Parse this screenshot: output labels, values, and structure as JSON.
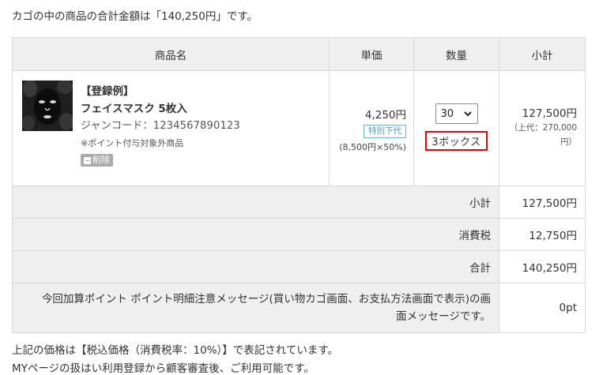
{
  "summary_text": "カゴの中の商品の合計金額は「140,250円」です。",
  "table": {
    "headers": {
      "product": "商品名",
      "unit_price": "単価",
      "quantity": "数量",
      "subtotal": "小計"
    },
    "item": {
      "tag": "【登録例】",
      "name": "フェイスマスク 5枚入",
      "jan": "ジャンコード：1234567890123",
      "note": "※ポイント付与対象外商品",
      "delete_label": "削除",
      "price": "4,250円",
      "price_badge": "特別下代",
      "price_detail": "(8,500円×50%)",
      "quantity_selected": "30",
      "quantity_boxes": "3ボックス",
      "subtotal": "127,500円",
      "subtotal_note_line1": "（上代：270,000",
      "subtotal_note_line2": "円）"
    },
    "totals": [
      {
        "label": "小計",
        "value": "127,500円"
      },
      {
        "label": "消費税",
        "value": "12,750円"
      },
      {
        "label": "合計",
        "value": "140,250円"
      }
    ],
    "points": {
      "label_line1": "今回加算ポイント ポイント明細注意メッセージ(買い物カゴ画面、お支払方法画面で表示)の画",
      "label_line2": "面メッセージです。",
      "value": "0pt"
    }
  },
  "footer": {
    "line1": "上記の価格は【税込価格（消費税率：10%）】で表記されています。",
    "line2": "MYページの扱はい利用登録から顧客審査後、ご利用可能です。"
  }
}
